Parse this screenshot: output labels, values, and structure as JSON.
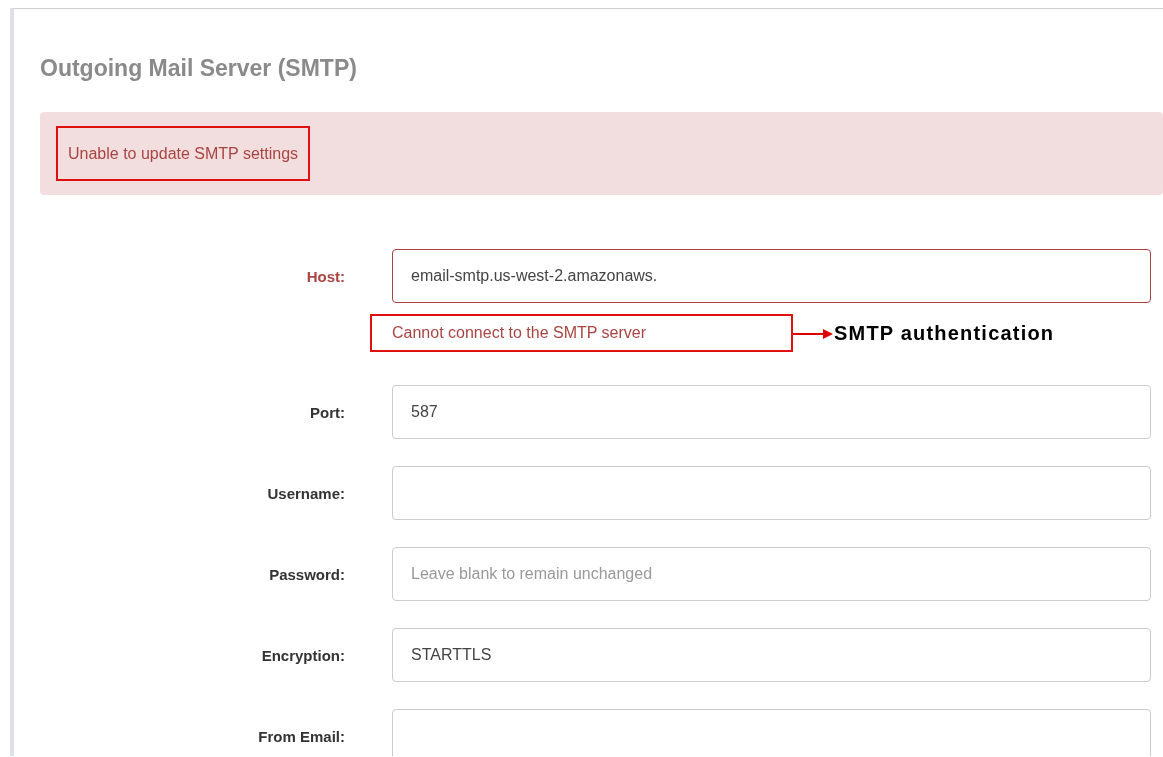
{
  "title": "Outgoing Mail Server (SMTP)",
  "alert": {
    "text": "Unable to update SMTP settings",
    "highlighted": true
  },
  "fields": [
    {
      "label": "Host:",
      "value": "email-smtp.us-west-2.amazonaws.",
      "error": true,
      "help": {
        "text": "Cannot connect to the SMTP server",
        "highlighted": true
      },
      "callout": "SMTP authentication"
    },
    {
      "label": "Port:",
      "value": "587",
      "error": false
    },
    {
      "label": "Username:",
      "error": false
    },
    {
      "label": "Password:",
      "placeholder": "Leave blank to remain unchanged",
      "error": false
    },
    {
      "label": "Encryption:",
      "value": "STARTTLS",
      "error": false
    },
    {
      "label": "From Email:",
      "error": false
    }
  ]
}
